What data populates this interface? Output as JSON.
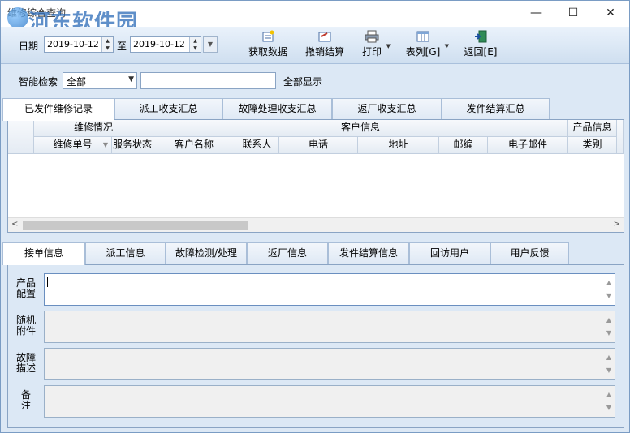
{
  "window": {
    "title": "维修综合查询",
    "watermark": "河东软件园",
    "controls": {
      "minimize": "—",
      "maximize": "☐",
      "close": "✕"
    }
  },
  "toolbar": {
    "date_label": "日期",
    "date_from": "2019-10-12",
    "date_to_label": "至",
    "date_to": "2019-10-12",
    "buttons": {
      "fetch": "获取数据",
      "cancel_settle": "撤销结算",
      "print": "打印",
      "columns": "表列[G]",
      "back": "返回[E]"
    }
  },
  "search": {
    "label": "智能检索",
    "scope_value": "全部",
    "query_value": "",
    "show_all_label": "全部显示"
  },
  "top_tabs": [
    "已发件维修记录",
    "派工收支汇总",
    "故障处理收支汇总",
    "返厂收支汇总",
    "发件结算汇总"
  ],
  "grid": {
    "groups": {
      "repair": "维修情况",
      "customer": "客户信息",
      "product": "产品信息"
    },
    "columns": {
      "repair_no": "维修单号",
      "service_status": "服务状态",
      "customer_name": "客户名称",
      "contact": "联系人",
      "phone": "电话",
      "address": "地址",
      "zip": "邮编",
      "email": "电子邮件",
      "category": "类别"
    }
  },
  "bottom_tabs": [
    "接单信息",
    "派工信息",
    "故障检测/处理",
    "返厂信息",
    "发件结算信息",
    "回访用户",
    "用户反馈"
  ],
  "detail": {
    "product_config": "产品配置",
    "accessories": "随机附件",
    "fault_desc": "故障描述",
    "remark": "备注"
  },
  "colors": {
    "background": "#dce8f5",
    "border": "#8aa4c4",
    "accent_red": "#c0392b",
    "accent_blue": "#2a6ab8"
  }
}
